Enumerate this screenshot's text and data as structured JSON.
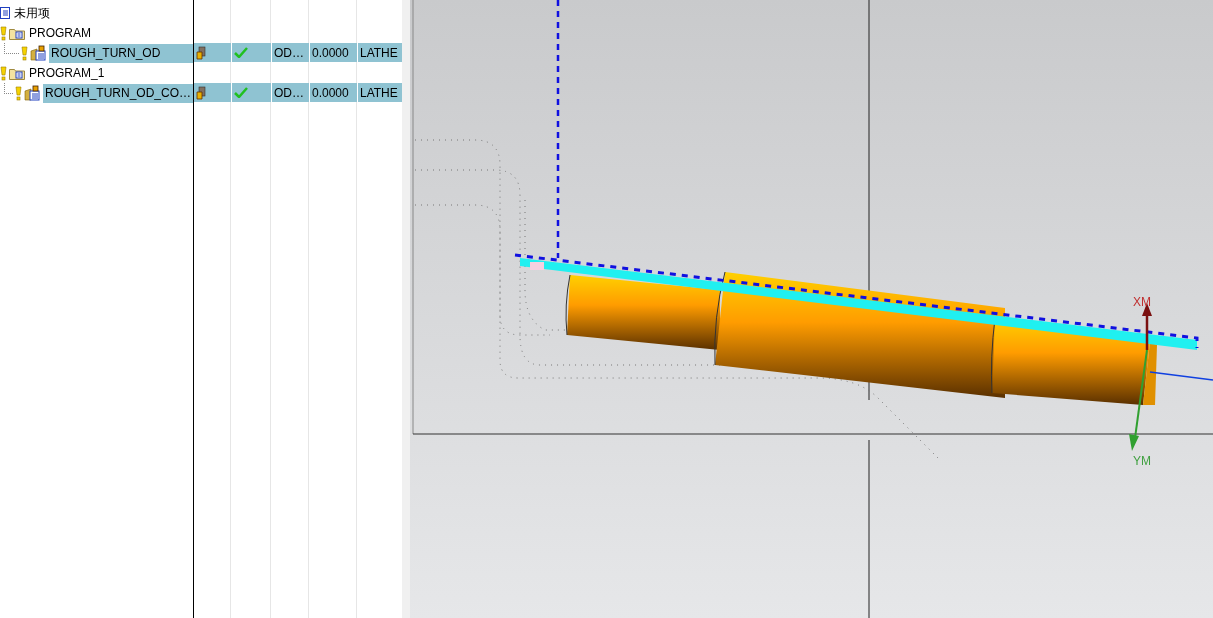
{
  "operation_navigator": {
    "rows": [
      {
        "kind": "root",
        "name": "未用项",
        "selected": false,
        "children": []
      },
      {
        "kind": "group",
        "name": "PROGRAM",
        "selected": false,
        "children": [
          {
            "kind": "operation",
            "name": "ROUGH_TURN_OD",
            "selected": true,
            "column_4": "OD…",
            "column_5": "0.0000",
            "column_6": "LATHE"
          }
        ]
      },
      {
        "kind": "group",
        "name": "PROGRAM_1",
        "selected": false,
        "children": [
          {
            "kind": "operation",
            "name": "ROUGH_TURN_OD_CO…",
            "selected": true,
            "column_4": "OD…",
            "column_5": "0.0000",
            "column_6": "LATHE"
          }
        ]
      }
    ]
  },
  "graphics_window": {
    "axis_labels": [
      "XM",
      "YM"
    ]
  }
}
